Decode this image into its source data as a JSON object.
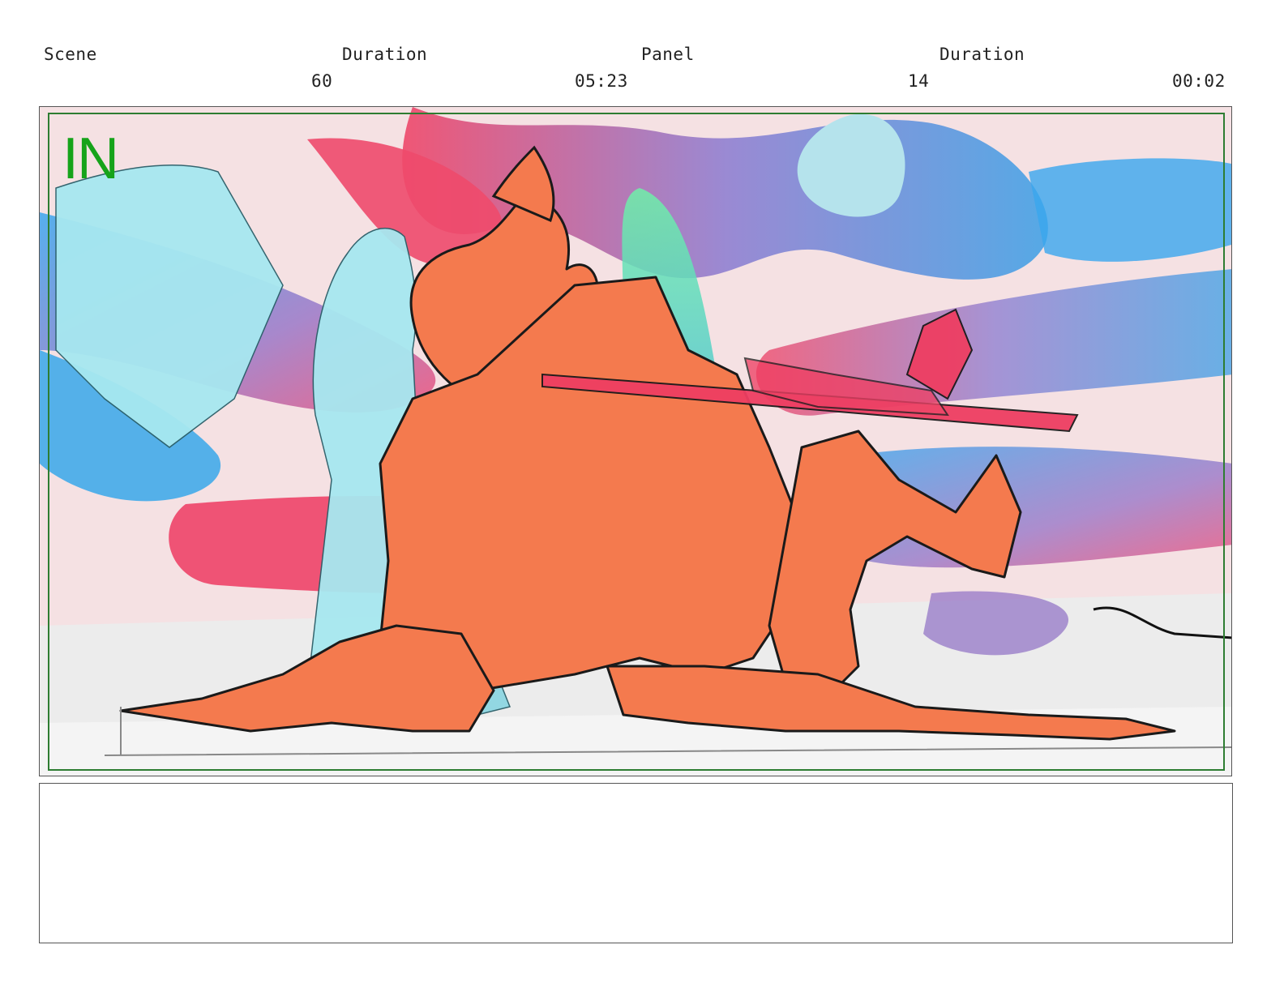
{
  "header": {
    "scene_label": "Scene",
    "scene_duration_label": "Duration",
    "panel_label": "Panel",
    "panel_duration_label": "Duration",
    "scene_value": "60",
    "scene_duration_value": "05:23",
    "panel_value": "14",
    "panel_duration_value": "00:02"
  },
  "panel": {
    "marker": "IN",
    "marker_color": "#16a31a",
    "safe_frame_color": "#2e7d32",
    "character_fill": "#f47a4e",
    "accent_red": "#ee3e62"
  },
  "notes": {
    "text": ""
  }
}
